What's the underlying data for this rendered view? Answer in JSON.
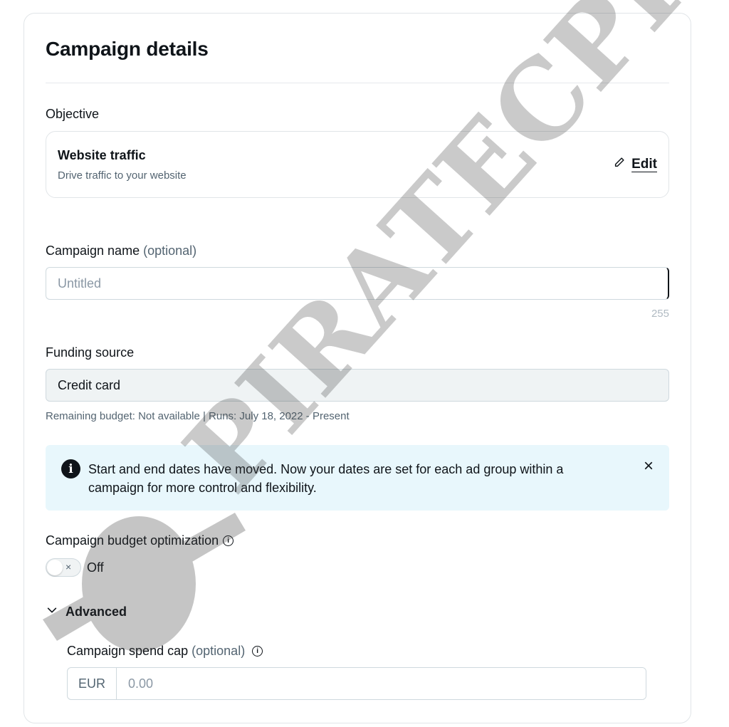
{
  "header": {
    "title": "Campaign details"
  },
  "objective": {
    "label": "Objective",
    "title": "Website traffic",
    "subtitle": "Drive traffic to your website",
    "edit_label": "Edit"
  },
  "campaign_name": {
    "label": "Campaign name",
    "optional": "(optional)",
    "placeholder": "Untitled",
    "char_limit": "255"
  },
  "funding": {
    "label": "Funding source",
    "value": "Credit card",
    "meta": "Remaining budget: Not available | Runs: July 18, 2022 - Present"
  },
  "info_banner": {
    "text": "Start and end dates have moved. Now your dates are set for each ad group within a campaign for more control and flexibility.",
    "icon_glyph": "i",
    "close_glyph": "×"
  },
  "budget_optimization": {
    "label": "Campaign budget optimization",
    "toggle_state": "Off",
    "toggle_glyph": "×"
  },
  "advanced": {
    "label": "Advanced",
    "spend_cap_label": "Campaign spend cap",
    "spend_cap_optional": "(optional)",
    "currency": "EUR",
    "placeholder": "0.00"
  },
  "watermark": {
    "text": "PIRATECPR"
  }
}
